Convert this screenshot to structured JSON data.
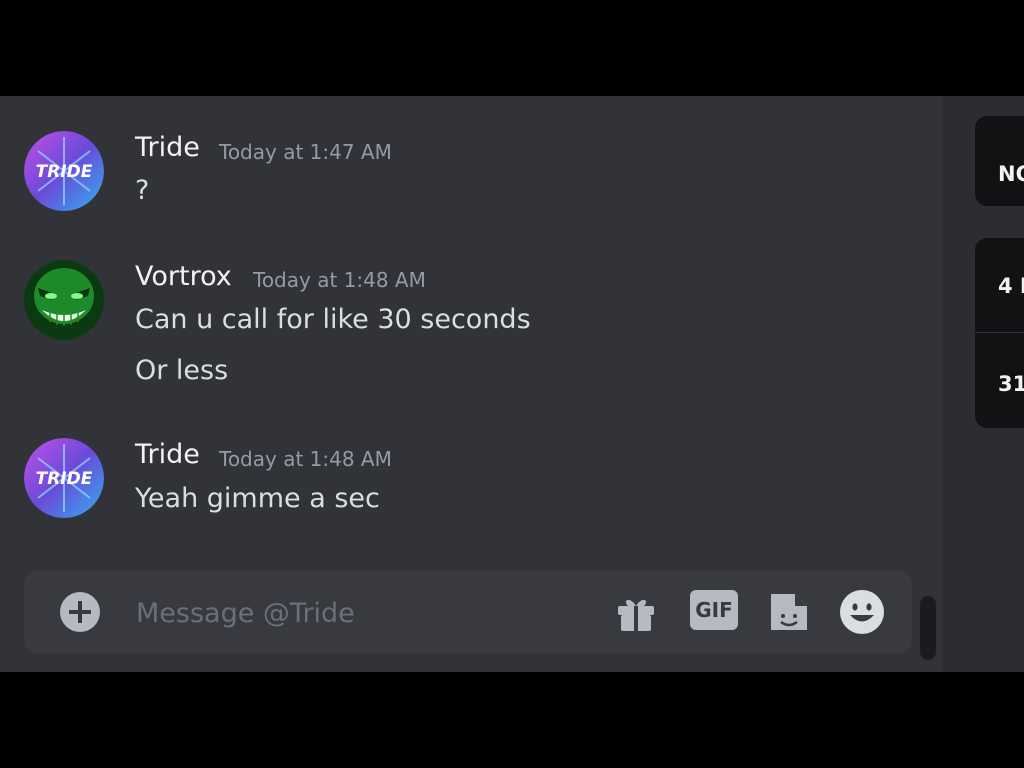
{
  "chat": {
    "messages": [
      {
        "author": "Tride",
        "timestamp": "Today at 1:47 AM",
        "lines": [
          "?"
        ],
        "avatar": "tride-logo-avatar",
        "avatar_text": "TRIDE"
      },
      {
        "author": "Vortrox",
        "timestamp": "Today at 1:48 AM",
        "lines": [
          "Can u call for like 30 seconds",
          "Or less"
        ],
        "avatar": "green-grinning-mask-avatar"
      },
      {
        "author": "Tride",
        "timestamp": "Today at 1:48 AM",
        "lines": [
          "Yeah gimme a sec"
        ],
        "avatar": "tride-logo-avatar",
        "avatar_text": "TRIDE"
      }
    ]
  },
  "composer": {
    "placeholder": "Message @Tride",
    "value": "",
    "buttons": {
      "attach": "plus-circle-icon",
      "gift": "gift-icon",
      "gif": "GIF",
      "sticker": "sticker-icon",
      "emoji": "emoji-icon"
    }
  },
  "right_panel": {
    "cards": [
      {
        "text": "NO"
      },
      {
        "text": "4 I"
      },
      {
        "text": "31"
      }
    ]
  },
  "colors": {
    "chat_bg": "#313338",
    "composer_bg": "#383a40",
    "username": "#f2f3f5",
    "timestamp": "#949ba4",
    "message_text": "#dbdee1"
  }
}
